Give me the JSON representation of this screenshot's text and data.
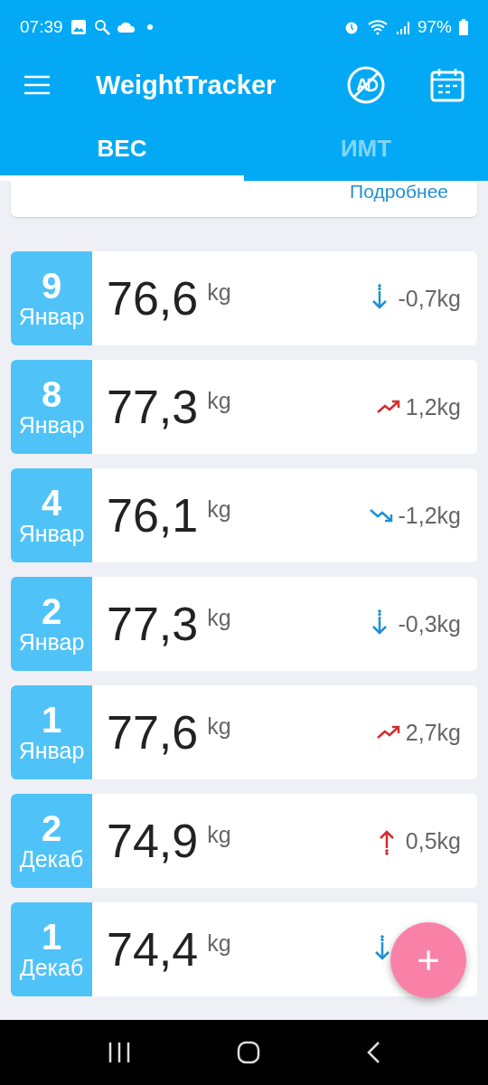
{
  "status_bar": {
    "time": "07:39",
    "battery": "97%"
  },
  "app_bar": {
    "title": "WeightTracker"
  },
  "tabs": [
    {
      "label": "ВЕС",
      "selected": true
    },
    {
      "label": "ИМТ",
      "selected": false
    }
  ],
  "summary_card": {
    "link": "Подробнее"
  },
  "entries": [
    {
      "day": "9",
      "month": "Январ",
      "weight": "76,6",
      "unit": "kg",
      "kind": "down",
      "delta": "-0,7kg"
    },
    {
      "day": "8",
      "month": "Январ",
      "weight": "77,3",
      "unit": "kg",
      "kind": "rise",
      "delta": "1,2kg"
    },
    {
      "day": "4",
      "month": "Январ",
      "weight": "76,1",
      "unit": "kg",
      "kind": "fall",
      "delta": "-1,2kg"
    },
    {
      "day": "2",
      "month": "Январ",
      "weight": "77,3",
      "unit": "kg",
      "kind": "down",
      "delta": "-0,3kg"
    },
    {
      "day": "1",
      "month": "Январ",
      "weight": "77,6",
      "unit": "kg",
      "kind": "rise",
      "delta": "2,7kg"
    },
    {
      "day": "2",
      "month": "Декаб",
      "weight": "74,9",
      "unit": "kg",
      "kind": "up",
      "delta": "0,5kg"
    },
    {
      "day": "1",
      "month": "Декаб",
      "weight": "74,4",
      "unit": "kg",
      "kind": "down"
    }
  ],
  "fab": {
    "label": "+"
  }
}
